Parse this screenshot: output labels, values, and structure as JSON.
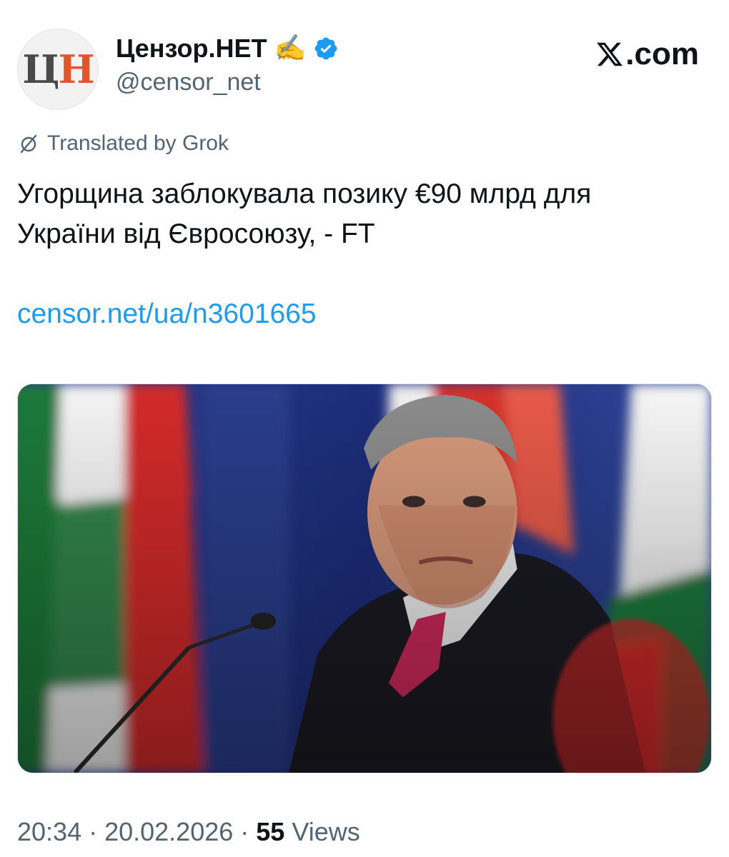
{
  "author": {
    "avatar_text_dark": "Ц",
    "avatar_text_accent": "Н",
    "display_name": "Цензор.НЕТ",
    "emoji": "✍️",
    "handle": "@censor_net"
  },
  "brand": {
    "label": ".com"
  },
  "translation": {
    "label": "Translated by Grok"
  },
  "tweet": {
    "text_line_1": "Угорщина заблокувала позику €90 млрд для",
    "text_line_2": "України від Євросоюзу, - FT",
    "link": "censor.net/ua/n3601665"
  },
  "meta": {
    "time": "20:34",
    "date": "20.02.2026",
    "separator": "·",
    "views_count": "55",
    "views_label": "Views"
  },
  "colors": {
    "link": "#1d9bf0",
    "muted": "#536471",
    "verified": "#1d9bf0",
    "avatar_accent": "#e3542b"
  },
  "icons": {
    "verified": "verified-badge-icon",
    "translate": "translate-slash-icon",
    "brand": "x-logo-icon"
  }
}
